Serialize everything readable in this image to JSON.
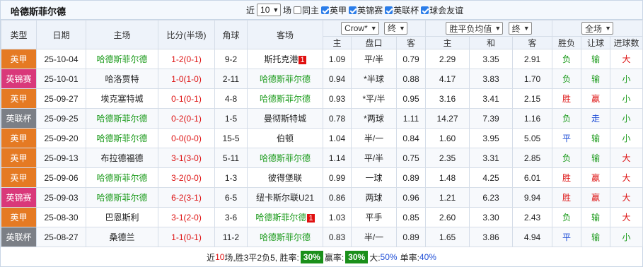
{
  "team_title": "哈德斯菲尔德",
  "filters": {
    "prefix": "近",
    "count_value": "10",
    "count_suffix": "场",
    "same_home_label": "同主",
    "competitions": [
      "英甲",
      "英锦赛",
      "英联杯",
      "球会友谊"
    ]
  },
  "header": {
    "type": "类型",
    "date": "日期",
    "home": "主场",
    "score": "比分(半场)",
    "corner": "角球",
    "away": "客场",
    "company_select": "Crow*",
    "odds_time_select_1": "终",
    "euro_select": "胜平负均值",
    "odds_time_select_2": "终",
    "scope_select": "全场",
    "win_loss": "胜负",
    "handicap_result": "让球",
    "goals_result": "进球数",
    "sub_home": "主",
    "sub_line": "盘口",
    "sub_away": "客",
    "sub_home2": "主",
    "sub_draw": "和",
    "sub_away2": "客"
  },
  "colors": {
    "英甲": "#e57a23",
    "英锦赛": "#d9387a",
    "英联杯": "#7b7f86"
  },
  "rows": [
    {
      "type": "英甲",
      "date": "25-10-04",
      "home": "哈德斯菲尔德",
      "home_hl": true,
      "score": "1-2",
      "half": "(0-1)",
      "corner": "9-2",
      "away": "斯托克港",
      "away_hl": false,
      "away_rank": "1",
      "ah_home": "1.09",
      "ah_line": "平/半",
      "ah_away": "0.79",
      "eu_home": "2.29",
      "eu_draw": "3.35",
      "eu_away": "2.91",
      "wl": "负",
      "wl_c": "green",
      "hc": "输",
      "hc_c": "green",
      "ou": "大",
      "ou_c": "red"
    },
    {
      "type": "英锦赛",
      "date": "25-10-01",
      "home": "哈洛贾特",
      "home_hl": false,
      "score": "1-0",
      "half": "(1-0)",
      "corner": "2-11",
      "away": "哈德斯菲尔德",
      "away_hl": true,
      "away_rank": "",
      "ah_home": "0.94",
      "ah_line": "*半球",
      "ah_away": "0.88",
      "eu_home": "4.17",
      "eu_draw": "3.83",
      "eu_away": "1.70",
      "wl": "负",
      "wl_c": "green",
      "hc": "输",
      "hc_c": "green",
      "ou": "小",
      "ou_c": "green"
    },
    {
      "type": "英甲",
      "date": "25-09-27",
      "home": "埃克塞特城",
      "home_hl": false,
      "score": "0-1",
      "half": "(0-1)",
      "corner": "4-8",
      "away": "哈德斯菲尔德",
      "away_hl": true,
      "away_rank": "",
      "ah_home": "0.93",
      "ah_line": "*平/半",
      "ah_away": "0.95",
      "eu_home": "3.16",
      "eu_draw": "3.41",
      "eu_away": "2.15",
      "wl": "胜",
      "wl_c": "red",
      "hc": "赢",
      "hc_c": "red",
      "ou": "小",
      "ou_c": "green"
    },
    {
      "type": "英联杯",
      "date": "25-09-25",
      "home": "哈德斯菲尔德",
      "home_hl": true,
      "score": "0-2",
      "half": "(0-1)",
      "corner": "1-5",
      "away": "曼彻斯特城",
      "away_hl": false,
      "away_rank": "",
      "ah_home": "0.78",
      "ah_line": "*两球",
      "ah_away": "1.11",
      "eu_home": "14.27",
      "eu_draw": "7.39",
      "eu_away": "1.16",
      "wl": "负",
      "wl_c": "green",
      "hc": "走",
      "hc_c": "blue",
      "ou": "小",
      "ou_c": "green"
    },
    {
      "type": "英甲",
      "date": "25-09-20",
      "home": "哈德斯菲尔德",
      "home_hl": true,
      "score": "0-0",
      "half": "(0-0)",
      "corner": "15-5",
      "away": "伯顿",
      "away_hl": false,
      "away_rank": "",
      "ah_home": "1.04",
      "ah_line": "半/一",
      "ah_away": "0.84",
      "eu_home": "1.60",
      "eu_draw": "3.95",
      "eu_away": "5.05",
      "wl": "平",
      "wl_c": "blue",
      "hc": "输",
      "hc_c": "green",
      "ou": "小",
      "ou_c": "green"
    },
    {
      "type": "英甲",
      "date": "25-09-13",
      "home": "布拉德福德",
      "home_hl": false,
      "score": "3-1",
      "half": "(3-0)",
      "corner": "5-11",
      "away": "哈德斯菲尔德",
      "away_hl": true,
      "away_rank": "",
      "ah_home": "1.14",
      "ah_line": "平/半",
      "ah_away": "0.75",
      "eu_home": "2.35",
      "eu_draw": "3.31",
      "eu_away": "2.85",
      "wl": "负",
      "wl_c": "green",
      "hc": "输",
      "hc_c": "green",
      "ou": "大",
      "ou_c": "red"
    },
    {
      "type": "英甲",
      "date": "25-09-06",
      "home": "哈德斯菲尔德",
      "home_hl": true,
      "score": "3-2",
      "half": "(0-0)",
      "corner": "1-3",
      "away": "彼得堡联",
      "away_hl": false,
      "away_rank": "",
      "ah_home": "0.99",
      "ah_line": "一球",
      "ah_away": "0.89",
      "eu_home": "1.48",
      "eu_draw": "4.25",
      "eu_away": "6.01",
      "wl": "胜",
      "wl_c": "red",
      "hc": "赢",
      "hc_c": "red",
      "ou": "大",
      "ou_c": "red"
    },
    {
      "type": "英锦赛",
      "date": "25-09-03",
      "home": "哈德斯菲尔德",
      "home_hl": true,
      "score": "6-2",
      "half": "(3-1)",
      "corner": "6-5",
      "away": "纽卡斯尔联U21",
      "away_hl": false,
      "away_rank": "",
      "ah_home": "0.86",
      "ah_line": "两球",
      "ah_away": "0.96",
      "eu_home": "1.21",
      "eu_draw": "6.23",
      "eu_away": "9.94",
      "wl": "胜",
      "wl_c": "red",
      "hc": "赢",
      "hc_c": "red",
      "ou": "大",
      "ou_c": "red"
    },
    {
      "type": "英甲",
      "date": "25-08-30",
      "home": "巴恩斯利",
      "home_hl": false,
      "score": "3-1",
      "half": "(2-0)",
      "corner": "3-6",
      "away": "哈德斯菲尔德",
      "away_hl": true,
      "away_rank": "1",
      "ah_home": "1.03",
      "ah_line": "平手",
      "ah_away": "0.85",
      "eu_home": "2.60",
      "eu_draw": "3.30",
      "eu_away": "2.43",
      "wl": "负",
      "wl_c": "green",
      "hc": "输",
      "hc_c": "green",
      "ou": "大",
      "ou_c": "red"
    },
    {
      "type": "英联杯",
      "date": "25-08-27",
      "home": "桑德兰",
      "home_hl": false,
      "score": "1-1",
      "half": "(0-1)",
      "corner": "11-2",
      "away": "哈德斯菲尔德",
      "away_hl": true,
      "away_rank": "",
      "ah_home": "0.83",
      "ah_line": "半/一",
      "ah_away": "0.89",
      "eu_home": "1.65",
      "eu_draw": "3.86",
      "eu_away": "4.94",
      "wl": "平",
      "wl_c": "blue",
      "hc": "输",
      "hc_c": "green",
      "ou": "小",
      "ou_c": "green"
    }
  ],
  "summary": {
    "prefix": "近",
    "count": "10",
    "record": "场,胜3平2负5, 胜率:",
    "win_rate": "30%",
    "ah_label": "赢率:",
    "ah_rate": "30%",
    "over_label": "大:",
    "over_rate": "50%",
    "odd_label": "单率:",
    "odd_rate": "40%"
  }
}
